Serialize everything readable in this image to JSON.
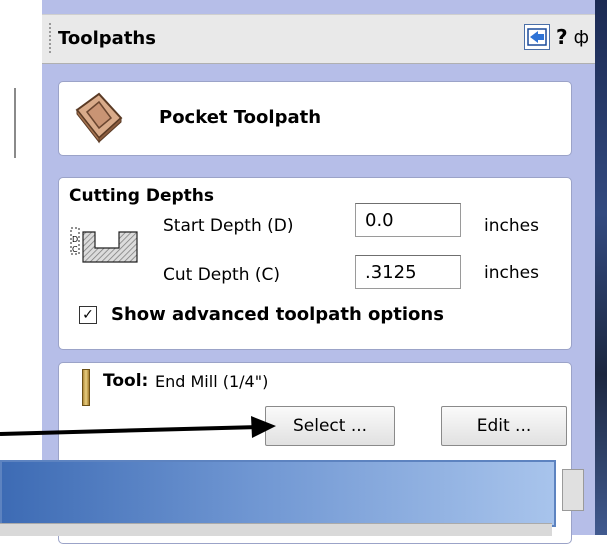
{
  "panel": {
    "title": "Toolpaths",
    "help_label": "?",
    "pin_label": "ф"
  },
  "pocket": {
    "title": "Pocket Toolpath"
  },
  "cutting_depths": {
    "title": "Cutting Depths",
    "start_label": "Start Depth (D)",
    "start_value": "0.0",
    "start_unit": "inches",
    "cut_label": "Cut Depth (C)",
    "cut_value": ".3125",
    "cut_unit": "inches",
    "advanced_checked": true,
    "advanced_label": "Show advanced toolpath options"
  },
  "tool": {
    "label": "Tool:",
    "value": "End Mill (1/4\")",
    "select_label": "Select ...",
    "edit_label": "Edit ..."
  },
  "colors": {
    "panel_bg": "#b6bee8",
    "arrow": "#000000",
    "overlay_gradient_start": "#3d6bb4",
    "overlay_gradient_end": "#a8c4ec"
  }
}
